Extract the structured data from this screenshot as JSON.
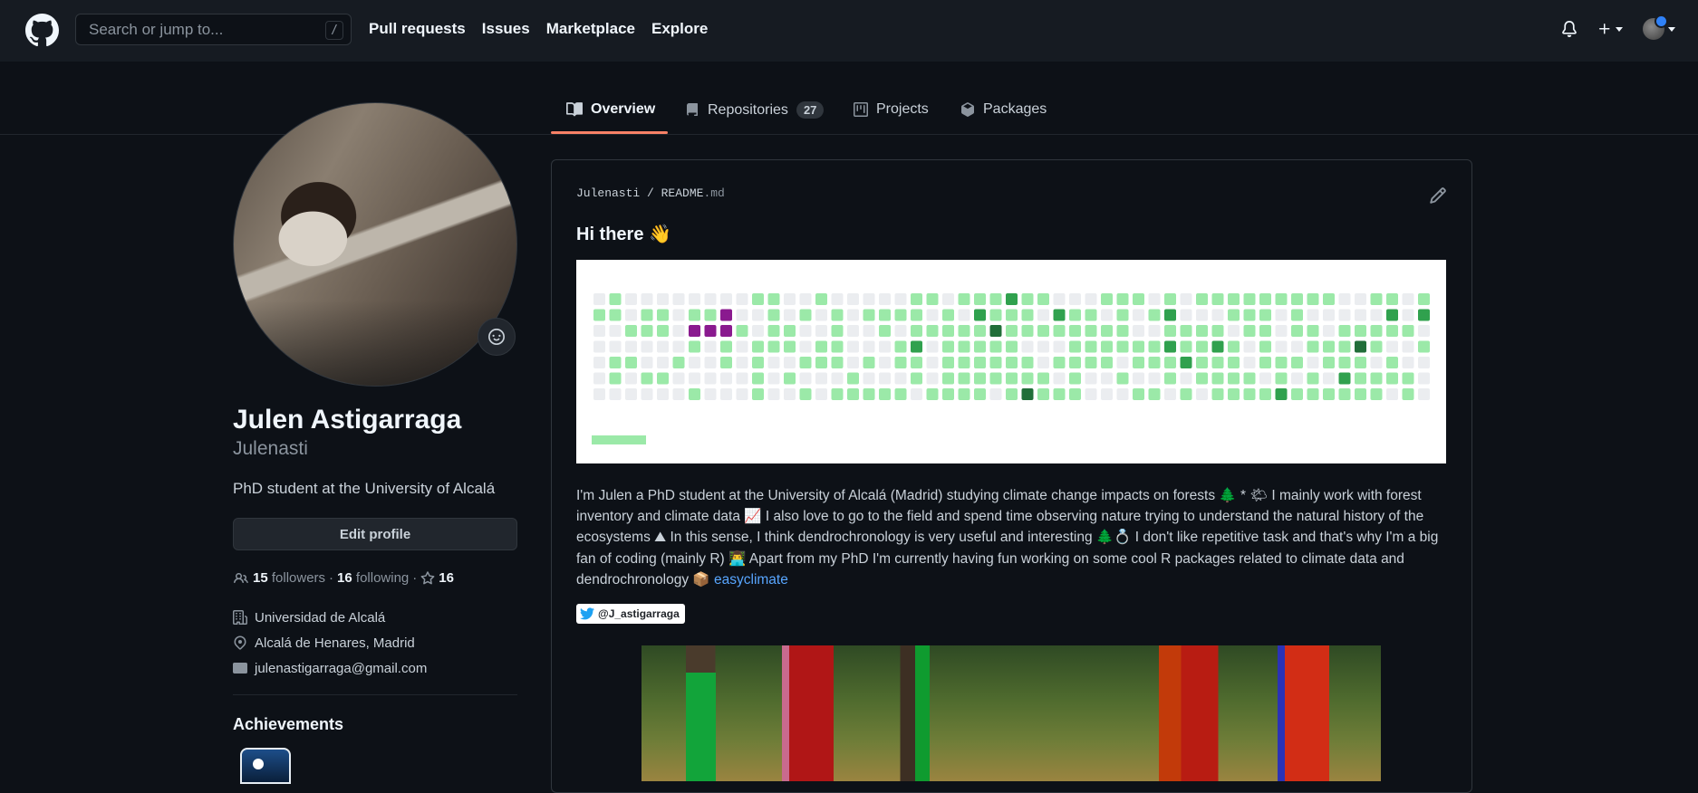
{
  "header": {
    "search_placeholder": "Search or jump to...",
    "search_shortcut": "/",
    "nav": [
      "Pull requests",
      "Issues",
      "Marketplace",
      "Explore"
    ]
  },
  "tabs": {
    "overview": "Overview",
    "repositories": "Repositories",
    "repositories_count": "27",
    "projects": "Projects",
    "packages": "Packages"
  },
  "profile": {
    "name": "Julen Astigarraga",
    "login": "Julenasti",
    "bio": "PhD student at the University of Alcalá",
    "edit_label": "Edit profile",
    "followers_count": "15",
    "followers_label": "followers",
    "following_count": "16",
    "following_label": "following",
    "stars_count": "16",
    "organization": "Universidad de Alcalá",
    "location": "Alcalá de Henares, Madrid",
    "email": "julenastigarraga@gmail.com",
    "achievements_title": "Achievements"
  },
  "readme": {
    "owner": "Julenasti",
    "file": "README",
    "ext": ".md",
    "greeting": "Hi there 👋",
    "paragraph": "I'm Julen a PhD student at the University of Alcalá (Madrid) studying climate change impacts on forests 🌲 * 🌤 I mainly work with forest inventory and climate data 📈 I also love to go to the field and spend time observing nature trying to understand the natural history of the ecosystems ⛰ In this sense, I think dendrochronology is very useful and interesting 🌲💍 I don't like repetitive task and that's why I'm a big fan of coding (mainly R) 👨‍💻 Apart from my PhD I'm currently having fun working on some cool R packages related to climate data and dendrochronology 📦",
    "link_text": "easyclimate",
    "twitter_handle": "@J_astigarraga"
  },
  "colors": {
    "bg": "#0d1117",
    "header_bg": "#161b22",
    "accent": "#f78166",
    "link": "#58a6ff",
    "contrib_empty": "#ebedf0",
    "contrib_l1": "#9be9a8",
    "contrib_l2": "#40c463",
    "contrib_l3": "#30a14e",
    "contrib_l4": "#216e39",
    "contrib_purple": "#8a1a8f"
  }
}
